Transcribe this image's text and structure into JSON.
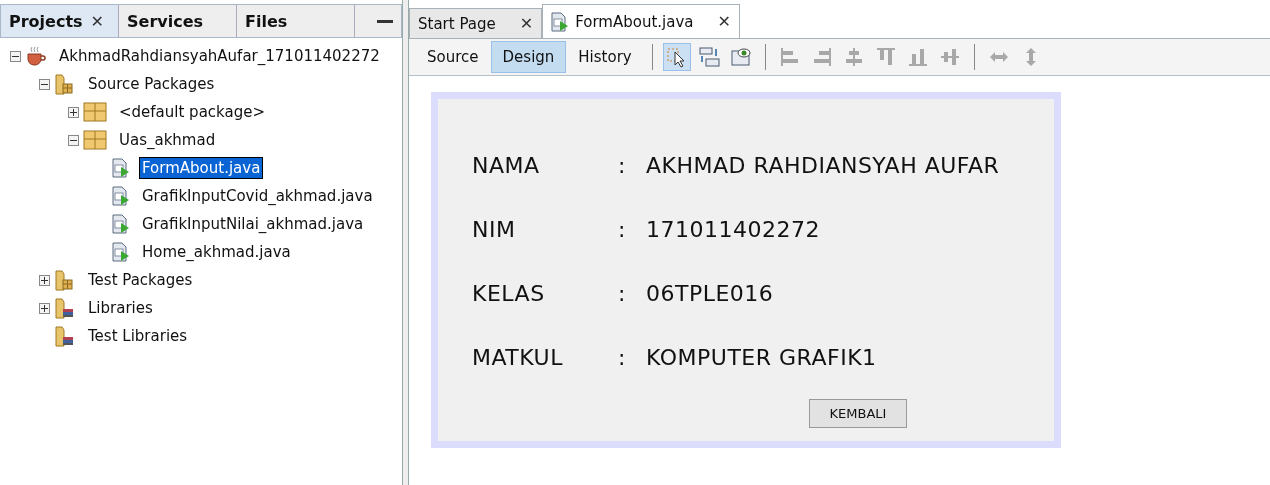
{
  "left_panel": {
    "tabs": [
      {
        "label": "Projects",
        "selected": true,
        "close": "✕"
      },
      {
        "label": "Services",
        "selected": false
      },
      {
        "label": "Files",
        "selected": false
      }
    ],
    "tree": [
      {
        "label": "AkhmadRahdiansyahAufar_171011402272",
        "kind": "project",
        "expanded": true,
        "selected": false,
        "children": [
          {
            "label": "Source Packages",
            "kind": "source-folder",
            "expanded": true,
            "selected": false,
            "children": [
              {
                "label": "<default package>",
                "kind": "package",
                "expanded": false,
                "selected": false
              },
              {
                "label": "Uas_akhmad",
                "kind": "package",
                "expanded": true,
                "selected": false,
                "children": [
                  {
                    "label": "FormAbout.java",
                    "kind": "form-file",
                    "selected": true
                  },
                  {
                    "label": "GrafikInputCovid_akhmad.java",
                    "kind": "form-file",
                    "selected": false
                  },
                  {
                    "label": "GrafikInputNilai_akhmad.java",
                    "kind": "form-file",
                    "selected": false
                  },
                  {
                    "label": "Home_akhmad.java",
                    "kind": "form-file",
                    "selected": false
                  }
                ]
              }
            ]
          },
          {
            "label": "Test Packages",
            "kind": "source-folder",
            "expanded": false,
            "selected": false
          },
          {
            "label": "Libraries",
            "kind": "library-folder",
            "expanded": false,
            "selected": false
          },
          {
            "label": "Test Libraries",
            "kind": "library-folder",
            "selected": false
          }
        ]
      }
    ]
  },
  "editor": {
    "tabs": [
      {
        "label": "Start Page",
        "selected": false,
        "file_icon": false,
        "close": "✕"
      },
      {
        "label": "FormAbout.java",
        "selected": true,
        "file_icon": true,
        "close": "✕"
      }
    ],
    "view_tabs": [
      {
        "label": "Source",
        "selected": false
      },
      {
        "label": "Design",
        "selected": true
      },
      {
        "label": "History",
        "selected": false
      }
    ],
    "toolbar": [
      {
        "kind": "select",
        "selected": true,
        "disabled": false
      },
      {
        "kind": "connect",
        "selected": false,
        "disabled": false
      },
      {
        "kind": "preview",
        "selected": false,
        "disabled": false
      },
      {
        "kind": "align-left",
        "selected": false,
        "disabled": true
      },
      {
        "kind": "align-right",
        "selected": false,
        "disabled": true
      },
      {
        "kind": "center-h",
        "selected": false,
        "disabled": true
      },
      {
        "kind": "align-top",
        "selected": false,
        "disabled": true
      },
      {
        "kind": "align-bottom",
        "selected": false,
        "disabled": true
      },
      {
        "kind": "center-v",
        "selected": false,
        "disabled": true
      },
      {
        "kind": "resize-h",
        "selected": false,
        "disabled": true
      },
      {
        "kind": "resize-v",
        "selected": false,
        "disabled": true
      }
    ],
    "form": {
      "rows": [
        {
          "label": "NAMA",
          "colon": ":",
          "value": "AKHMAD RAHDIANSYAH AUFAR"
        },
        {
          "label": "NIM",
          "colon": ":",
          "value": "171011402272"
        },
        {
          "label": "KELAS",
          "colon": ":",
          "value": "06TPLE016"
        },
        {
          "label": "MATKUL",
          "colon": ":",
          "value": "KOMPUTER GRAFIK1"
        }
      ],
      "button": "KEMBALI"
    }
  }
}
